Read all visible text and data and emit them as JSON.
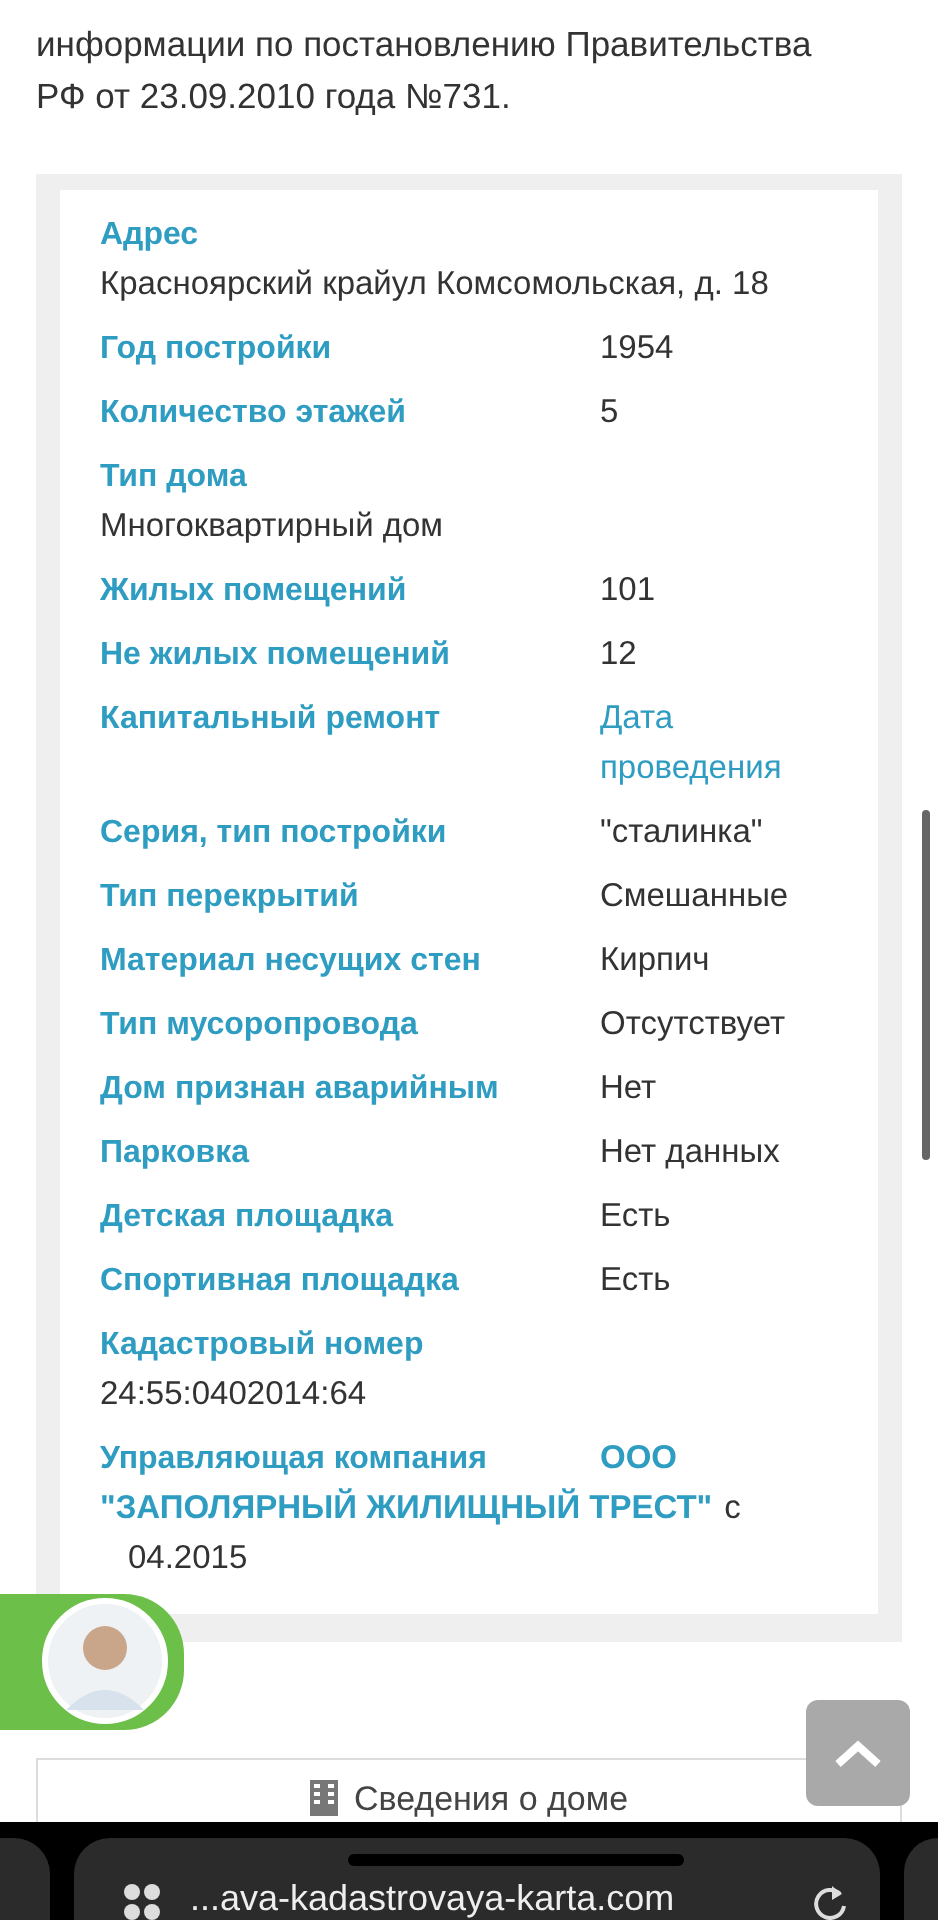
{
  "intro": "информации по постановлению Правительства РФ от 23.09.2010 года №731.",
  "fields": [
    {
      "kind": "stacked",
      "label": "Адрес",
      "value": "Красноярский крайул Комсомольская, д. 18"
    },
    {
      "kind": "pair",
      "label": "Год постройки",
      "value": "1954"
    },
    {
      "kind": "pair",
      "label": "Количество этажей",
      "value": "5"
    },
    {
      "kind": "stacked",
      "label": "Тип дома",
      "value": "Многоквартирный дом"
    },
    {
      "kind": "pair",
      "label": "Жилых помещений",
      "value": "101"
    },
    {
      "kind": "pair",
      "label": "Не жилых помещений",
      "value": "12"
    },
    {
      "kind": "pair_link",
      "label": "Капитальный ремонт",
      "value": "Дата проведения"
    },
    {
      "kind": "pair",
      "label": "Серия, тип постройки",
      "value": "\"сталинка\""
    },
    {
      "kind": "pair",
      "label": "Тип перекрытий",
      "value": "Смешанные"
    },
    {
      "kind": "pair",
      "label": "Материал несущих стен",
      "value": "Кирпич"
    },
    {
      "kind": "pair",
      "label": "Тип мусоропровода",
      "value": "Отсутствует"
    },
    {
      "kind": "pair",
      "label": "Дом признан аварийным",
      "value": "Нет"
    },
    {
      "kind": "pair",
      "label": "Парковка",
      "value": "Нет данных"
    },
    {
      "kind": "pair",
      "label": "Детская площадка",
      "value": "Есть"
    },
    {
      "kind": "pair",
      "label": "Спортивная площадка",
      "value": "Есть"
    },
    {
      "kind": "stacked",
      "label": "Кадастровый номер",
      "value": "24:55:0402014:64"
    },
    {
      "kind": "company",
      "label": "Управляющая компания",
      "link_first": "ООО",
      "link_rest": "\"ЗАПОЛЯРНЫЙ ЖИЛИЩНЫЙ ТРЕСТ\"",
      "suffix": "с",
      "date": "04.2015"
    }
  ],
  "bottom_button": {
    "label": "Сведения о доме"
  },
  "browser": {
    "url": "...ava-kadastrovaya-karta.com"
  }
}
